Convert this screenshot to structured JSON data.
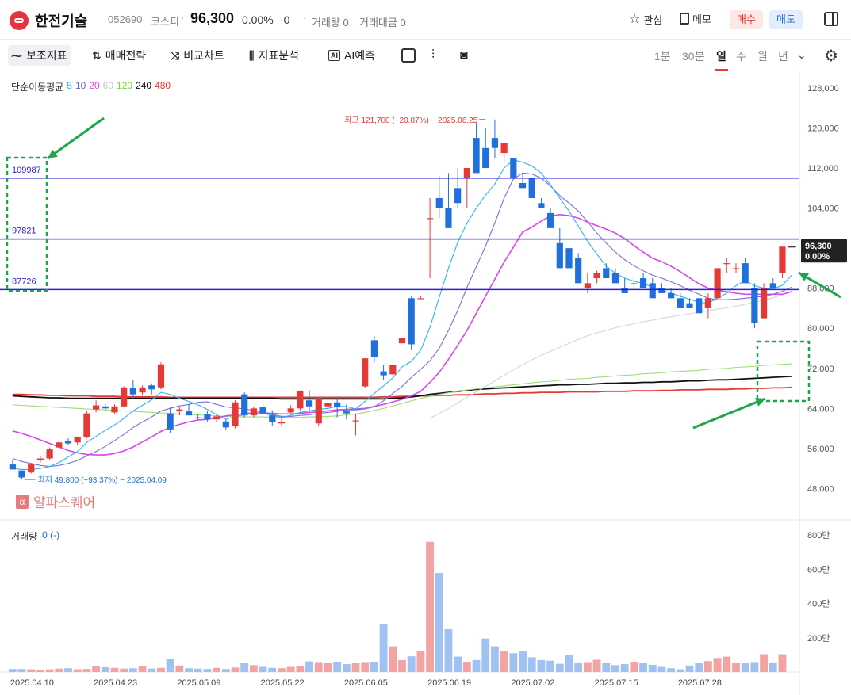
{
  "header": {
    "stock_name": "한전기술",
    "stock_code": "052690",
    "market": "코스피",
    "separator": "·",
    "price": "96,300",
    "change_pct": "0.00%",
    "change_abs": "-0",
    "volume": "거래량 0",
    "amount": "거래대금 0",
    "interest_label": "관심",
    "memo_label": "메모",
    "buy_label": "매수",
    "sell_label": "매도",
    "colors": {
      "buy": "#e53935",
      "sell": "#1f6fde",
      "logo": "#e8323c"
    }
  },
  "toolbar": {
    "indicator_label": "보조지표",
    "strategy_label": "매매전략",
    "compare_label": "비교차트",
    "analysis_label": "지표분석",
    "ai_label": "AI예측",
    "ai_badge": "AI",
    "periods": [
      "1분",
      "30분",
      "일",
      "주",
      "월",
      "년"
    ],
    "selected_period": "일"
  },
  "legend": {
    "ma_title": "단순이동평균",
    "ma_items": [
      {
        "label": "5",
        "color": "#29b6f6"
      },
      {
        "label": "10",
        "color": "#6a5acd"
      },
      {
        "label": "20",
        "color": "#d946ef"
      },
      {
        "label": "60",
        "color": "#c8c8c8"
      },
      {
        "label": "120",
        "color": "#7ccc45"
      },
      {
        "label": "240",
        "color": "#111111"
      },
      {
        "label": "480",
        "color": "#e53935"
      }
    ],
    "volume_title": "거래량",
    "volume_value": "0 (-)"
  },
  "watermark": {
    "text": "알파스퀘어",
    "glyph": "α"
  },
  "chart_data": {
    "type": "candlestick",
    "y_ticks": [
      "128,000",
      "120,000",
      "112,000",
      "104,000",
      "96,000",
      "88,000",
      "80,000",
      "72,000",
      "64,000",
      "56,000",
      "48,000"
    ],
    "y_tick_values": [
      128000,
      120000,
      112000,
      104000,
      96000,
      88000,
      80000,
      72000,
      64000,
      56000,
      48000
    ],
    "ylim": [
      43000,
      131000
    ],
    "vol_ticks": [
      "800만",
      "600만",
      "400만",
      "200만"
    ],
    "vol_tick_values": [
      800,
      600,
      400,
      200
    ],
    "vol_lim": [
      0,
      870
    ],
    "x_labels": [
      "2025.04.10",
      "2025.04.23",
      "2025.05.09",
      "2025.05.22",
      "2025.06.05",
      "2025.06.19",
      "2025.07.02",
      "2025.07.15",
      "2025.07.28"
    ],
    "x_label_index": [
      0,
      9,
      18,
      27,
      36,
      45,
      54,
      63,
      72
    ],
    "current_price": "96,300",
    "current_pct": "0.00%",
    "current_value": 96300,
    "high_label": "최고 121,700 (−20.87%) − 2025.06.25",
    "high_value": 121700,
    "high_index": 51,
    "low_label": "최저 49,800 (+93.37%) − 2025.04.09",
    "low_value": 49800,
    "low_index": 1,
    "levels": [
      {
        "label": "109987",
        "value": 109987
      },
      {
        "label": "97821",
        "value": 97821
      },
      {
        "label": "87726",
        "value": 87726
      }
    ],
    "candles": [
      [
        52800,
        53600,
        51800,
        51800
      ],
      [
        51600,
        51600,
        49800,
        50200
      ],
      [
        51200,
        53000,
        51000,
        52800
      ],
      [
        53600,
        54500,
        53200,
        54000
      ],
      [
        54000,
        56200,
        53600,
        55800
      ],
      [
        56200,
        57600,
        55800,
        57200
      ],
      [
        57400,
        58000,
        56600,
        57000
      ],
      [
        57200,
        58400,
        56800,
        58200
      ],
      [
        58200,
        63400,
        58000,
        63000
      ],
      [
        63800,
        65600,
        63200,
        64600
      ],
      [
        64400,
        65000,
        63400,
        64000
      ],
      [
        63200,
        64800,
        62800,
        64400
      ],
      [
        64400,
        68400,
        64200,
        68200
      ],
      [
        68000,
        69600,
        66000,
        66800
      ],
      [
        67200,
        68600,
        66600,
        68200
      ],
      [
        68600,
        69000,
        66800,
        67800
      ],
      [
        68200,
        73200,
        67800,
        72800
      ],
      [
        63000,
        64200,
        59000,
        59800
      ],
      [
        63400,
        64400,
        62600,
        63800
      ],
      [
        63400,
        64800,
        62600,
        62600
      ],
      [
        62200,
        62800,
        61600,
        62000
      ],
      [
        62800,
        63400,
        61400,
        61800
      ],
      [
        61800,
        62800,
        61200,
        62400
      ],
      [
        61400,
        61800,
        59600,
        60200
      ],
      [
        60400,
        65600,
        60000,
        65200
      ],
      [
        66800,
        67200,
        62200,
        62600
      ],
      [
        62600,
        64400,
        62200,
        64000
      ],
      [
        64200,
        65200,
        62800,
        63000
      ],
      [
        62600,
        63600,
        60400,
        61200
      ],
      [
        61000,
        62200,
        60400,
        61200
      ],
      [
        63200,
        64600,
        63000,
        64000
      ],
      [
        64000,
        67600,
        63600,
        67400
      ],
      [
        65600,
        67600,
        63600,
        64400
      ],
      [
        61000,
        66000,
        60400,
        66000
      ],
      [
        64400,
        65800,
        63400,
        65000
      ],
      [
        65200,
        66000,
        62200,
        64200
      ],
      [
        63400,
        64800,
        61800,
        63000
      ],
      [
        61600,
        63000,
        58600,
        61600
      ],
      [
        68400,
        74000,
        68000,
        74000
      ],
      [
        77600,
        78400,
        73200,
        74200
      ],
      [
        71400,
        72600,
        69600,
        70600
      ],
      [
        70800,
        72400,
        70400,
        72600
      ],
      [
        77000,
        78000,
        77000,
        78000
      ],
      [
        86000,
        86400,
        75600,
        76800
      ],
      [
        86000,
        86400,
        86000,
        86000
      ],
      [
        102000,
        106000,
        90000,
        102000
      ],
      [
        106000,
        110400,
        102000,
        104000
      ],
      [
        104000,
        111000,
        100000,
        100000
      ],
      [
        108000,
        112000,
        104000,
        105000
      ],
      [
        110000,
        112000,
        104000,
        112000
      ],
      [
        118000,
        121000,
        111000,
        111000
      ],
      [
        116000,
        120000,
        116000,
        112000
      ],
      [
        118000,
        121700,
        114000,
        116000
      ],
      [
        115000,
        117000,
        113000,
        117000
      ],
      [
        114000,
        114000,
        113000,
        110000
      ],
      [
        109000,
        111000,
        108000,
        108000
      ],
      [
        110000,
        110000,
        108000,
        106000
      ],
      [
        105000,
        106000,
        104000,
        104000
      ],
      [
        103000,
        104000,
        100000,
        100000
      ],
      [
        97000,
        100000,
        94000,
        92000
      ],
      [
        96000,
        97000,
        92000,
        92000
      ],
      [
        94000,
        95000,
        90000,
        89000
      ],
      [
        88000,
        91000,
        87000,
        89000
      ],
      [
        90000,
        91500,
        89000,
        91000
      ],
      [
        92000,
        93000,
        90000,
        90000
      ],
      [
        91000,
        92000,
        89000,
        89000
      ],
      [
        88000,
        90000,
        87000,
        87000
      ],
      [
        89000,
        90500,
        88000,
        89000
      ],
      [
        90000,
        91000,
        88000,
        88000
      ],
      [
        89000,
        90000,
        86000,
        86000
      ],
      [
        88000,
        89000,
        87000,
        87000
      ],
      [
        87000,
        88000,
        86000,
        86000
      ],
      [
        86000,
        87000,
        84000,
        84000
      ],
      [
        85000,
        86000,
        84000,
        84000
      ],
      [
        86000,
        86000,
        84000,
        83000
      ],
      [
        84000,
        87000,
        82000,
        86000
      ],
      [
        86000,
        92000,
        86000,
        92000
      ],
      [
        93000,
        94000,
        91000,
        93000
      ],
      [
        92000,
        93000,
        91000,
        92000
      ],
      [
        93000,
        94000,
        89000,
        89000
      ],
      [
        88000,
        89000,
        80000,
        81000
      ],
      [
        82000,
        89000,
        82000,
        88000
      ],
      [
        89000,
        90000,
        88000,
        88000
      ],
      [
        91000,
        96300,
        90000,
        96300
      ],
      [
        96300,
        96300,
        96300,
        96300
      ]
    ],
    "volumes": [
      18,
      18,
      16,
      14,
      16,
      20,
      22,
      16,
      18,
      36,
      28,
      24,
      20,
      22,
      32,
      20,
      24,
      78,
      38,
      22,
      20,
      18,
      24,
      18,
      26,
      52,
      40,
      30,
      24,
      22,
      30,
      34,
      62,
      58,
      52,
      60,
      46,
      52,
      58,
      60,
      280,
      150,
      70,
      92,
      120,
      760,
      578,
      250,
      90,
      60,
      70,
      196,
      150,
      120,
      110,
      120,
      86,
      70,
      66,
      48,
      100,
      56,
      58,
      72,
      52,
      40,
      46,
      60,
      54,
      42,
      30,
      22,
      16,
      38,
      54,
      64,
      82,
      90,
      54,
      52,
      58,
      104,
      56,
      104
    ],
    "ma5": [
      52000,
      51800,
      51800,
      52000,
      52400,
      53200,
      54300,
      55400,
      57200,
      58400,
      59600,
      60700,
      62000,
      63500,
      64600,
      65700,
      67200,
      66800,
      66000,
      65400,
      64700,
      63800,
      62700,
      61800,
      62400,
      62700,
      63000,
      63000,
      62600,
      62200,
      62600,
      63200,
      63500,
      63800,
      64000,
      64400,
      64400,
      63900,
      65400,
      67000,
      68500,
      70100,
      72300,
      73400,
      75600,
      80200,
      86200,
      92000,
      97200,
      101000,
      104000,
      106600,
      108800,
      112000,
      113600,
      113200,
      112400,
      111000,
      108600,
      106000,
      103400,
      100400,
      97400,
      94800,
      92400,
      91000,
      90000,
      89400,
      89000,
      88200,
      87600,
      87000,
      86400,
      85800,
      85200,
      85000,
      86000,
      87000,
      88500,
      89500,
      88500,
      88000,
      87800,
      88600,
      90600
    ],
    "ma10": [
      54000,
      53400,
      53000,
      52600,
      52400,
      52600,
      53000,
      53600,
      54500,
      55400,
      56400,
      57600,
      58800,
      60200,
      61300,
      62300,
      63500,
      64000,
      64500,
      64800,
      65200,
      65300,
      64800,
      64300,
      64100,
      63900,
      63600,
      63200,
      62800,
      62400,
      62400,
      62600,
      62700,
      63000,
      63200,
      63400,
      63700,
      63700,
      63900,
      64300,
      65500,
      67000,
      68400,
      70200,
      71800,
      73500,
      76000,
      79600,
      83600,
      88200,
      92300,
      96400,
      101000,
      106000,
      109800,
      111000,
      110800,
      110000,
      108400,
      106500,
      105000,
      103400,
      101300,
      99000,
      97000,
      95200,
      93700,
      92500,
      91500,
      90600,
      90000,
      89300,
      88500,
      87600,
      86800,
      86000,
      85700,
      85700,
      85800,
      86000,
      86200,
      86400,
      86800,
      87400,
      88200
    ],
    "ma20": [
      59500,
      59000,
      58400,
      57700,
      57000,
      56300,
      55600,
      55100,
      54800,
      54700,
      54700,
      55000,
      55500,
      56300,
      57300,
      58300,
      59400,
      60200,
      60800,
      61300,
      61700,
      61800,
      62100,
      62500,
      62700,
      63000,
      63100,
      63100,
      63000,
      62900,
      62900,
      63000,
      63200,
      63300,
      63500,
      63700,
      63800,
      63900,
      64000,
      64400,
      64800,
      65300,
      65800,
      66500,
      67400,
      69200,
      71200,
      73800,
      76600,
      79600,
      83000,
      86400,
      89800,
      93200,
      96200,
      99200,
      100200,
      101400,
      102400,
      102700,
      102500,
      102000,
      101200,
      100500,
      99800,
      99000,
      97900,
      96500,
      95200,
      94000,
      93300,
      92400,
      91300,
      90100,
      88900,
      88000,
      87600,
      87300,
      87000,
      86800,
      86800,
      86800,
      86800,
      86800,
      87300
    ],
    "ma60": [
      null,
      null,
      null,
      null,
      null,
      null,
      null,
      null,
      null,
      null,
      null,
      null,
      null,
      null,
      null,
      null,
      null,
      null,
      null,
      null,
      null,
      null,
      null,
      null,
      null,
      null,
      null,
      null,
      null,
      null,
      null,
      null,
      null,
      null,
      null,
      null,
      null,
      null,
      null,
      null,
      null,
      null,
      null,
      null,
      null,
      62000,
      63000,
      64000,
      65100,
      66200,
      67300,
      68400,
      69500,
      70600,
      71700,
      72700,
      73700,
      74600,
      75400,
      76200,
      77000,
      77800,
      78500,
      79100,
      79600,
      80100,
      80500,
      80900,
      81300,
      81600,
      82000,
      82300,
      82600,
      82900,
      83200,
      83500,
      83800,
      84100,
      84400,
      84800,
      85200,
      85600,
      86100,
      86700,
      87400
    ],
    "ma120": [
      64700,
      64600,
      64500,
      64400,
      64300,
      64200,
      64100,
      64000,
      63900,
      63800,
      63700,
      63600,
      63500,
      63400,
      63300,
      63200,
      63100,
      63000,
      62900,
      62800,
      62700,
      62600,
      62500,
      62400,
      62400,
      62300,
      62300,
      62300,
      62200,
      62200,
      62200,
      62200,
      62300,
      62300,
      62400,
      62500,
      62700,
      62900,
      63200,
      63600,
      64000,
      64500,
      65000,
      65500,
      66000,
      66400,
      66800,
      67100,
      67400,
      67700,
      67900,
      68100,
      68300,
      68500,
      68700,
      68900,
      69100,
      69300,
      69400,
      69600,
      69800,
      69900,
      70000,
      70200,
      70300,
      70500,
      70600,
      70700,
      70900,
      71000,
      71100,
      71300,
      71400,
      71500,
      71600,
      71800,
      71900,
      72000,
      72200,
      72300,
      72400,
      72600,
      72700,
      72800,
      72900
    ],
    "ma240": [
      66500,
      66400,
      66300,
      66200,
      66100,
      66100,
      66000,
      66000,
      66000,
      66000,
      66000,
      66000,
      66000,
      66000,
      66000,
      66000,
      66000,
      66000,
      66000,
      66000,
      66000,
      66000,
      66000,
      66000,
      66000,
      66000,
      66000,
      66000,
      66000,
      65900,
      65900,
      65900,
      65900,
      65900,
      65900,
      65900,
      65900,
      65900,
      65900,
      65900,
      65900,
      66000,
      66100,
      66300,
      66500,
      66800,
      67000,
      67200,
      67400,
      67600,
      67800,
      67900,
      68000,
      68100,
      68200,
      68300,
      68400,
      68500,
      68600,
      68700,
      68700,
      68800,
      68800,
      68900,
      69000,
      69000,
      69100,
      69100,
      69200,
      69200,
      69300,
      69300,
      69400,
      69500,
      69500,
      69600,
      69700,
      69700,
      69800,
      69900,
      70000,
      70100,
      70200,
      70300,
      70400
    ],
    "ma480": [
      66800,
      66800,
      66700,
      66700,
      66600,
      66600,
      66500,
      66500,
      66500,
      66400,
      66400,
      66400,
      66300,
      66300,
      66300,
      66300,
      66300,
      66200,
      66200,
      66200,
      66200,
      66200,
      66200,
      66200,
      66200,
      66200,
      66200,
      66200,
      66200,
      66200,
      66200,
      66200,
      66200,
      66200,
      66200,
      66200,
      66200,
      66200,
      66200,
      66200,
      66300,
      66300,
      66400,
      66400,
      66500,
      66500,
      66600,
      66600,
      66700,
      66700,
      66800,
      66900,
      66900,
      67000,
      67000,
      67100,
      67100,
      67200,
      67200,
      67200,
      67300,
      67300,
      67300,
      67300,
      67400,
      67400,
      67400,
      67500,
      67500,
      67500,
      67600,
      67600,
      67700,
      67700,
      67700,
      67800,
      67800,
      67800,
      67900,
      67900,
      68000,
      68000,
      68100,
      68100,
      68200
    ]
  }
}
